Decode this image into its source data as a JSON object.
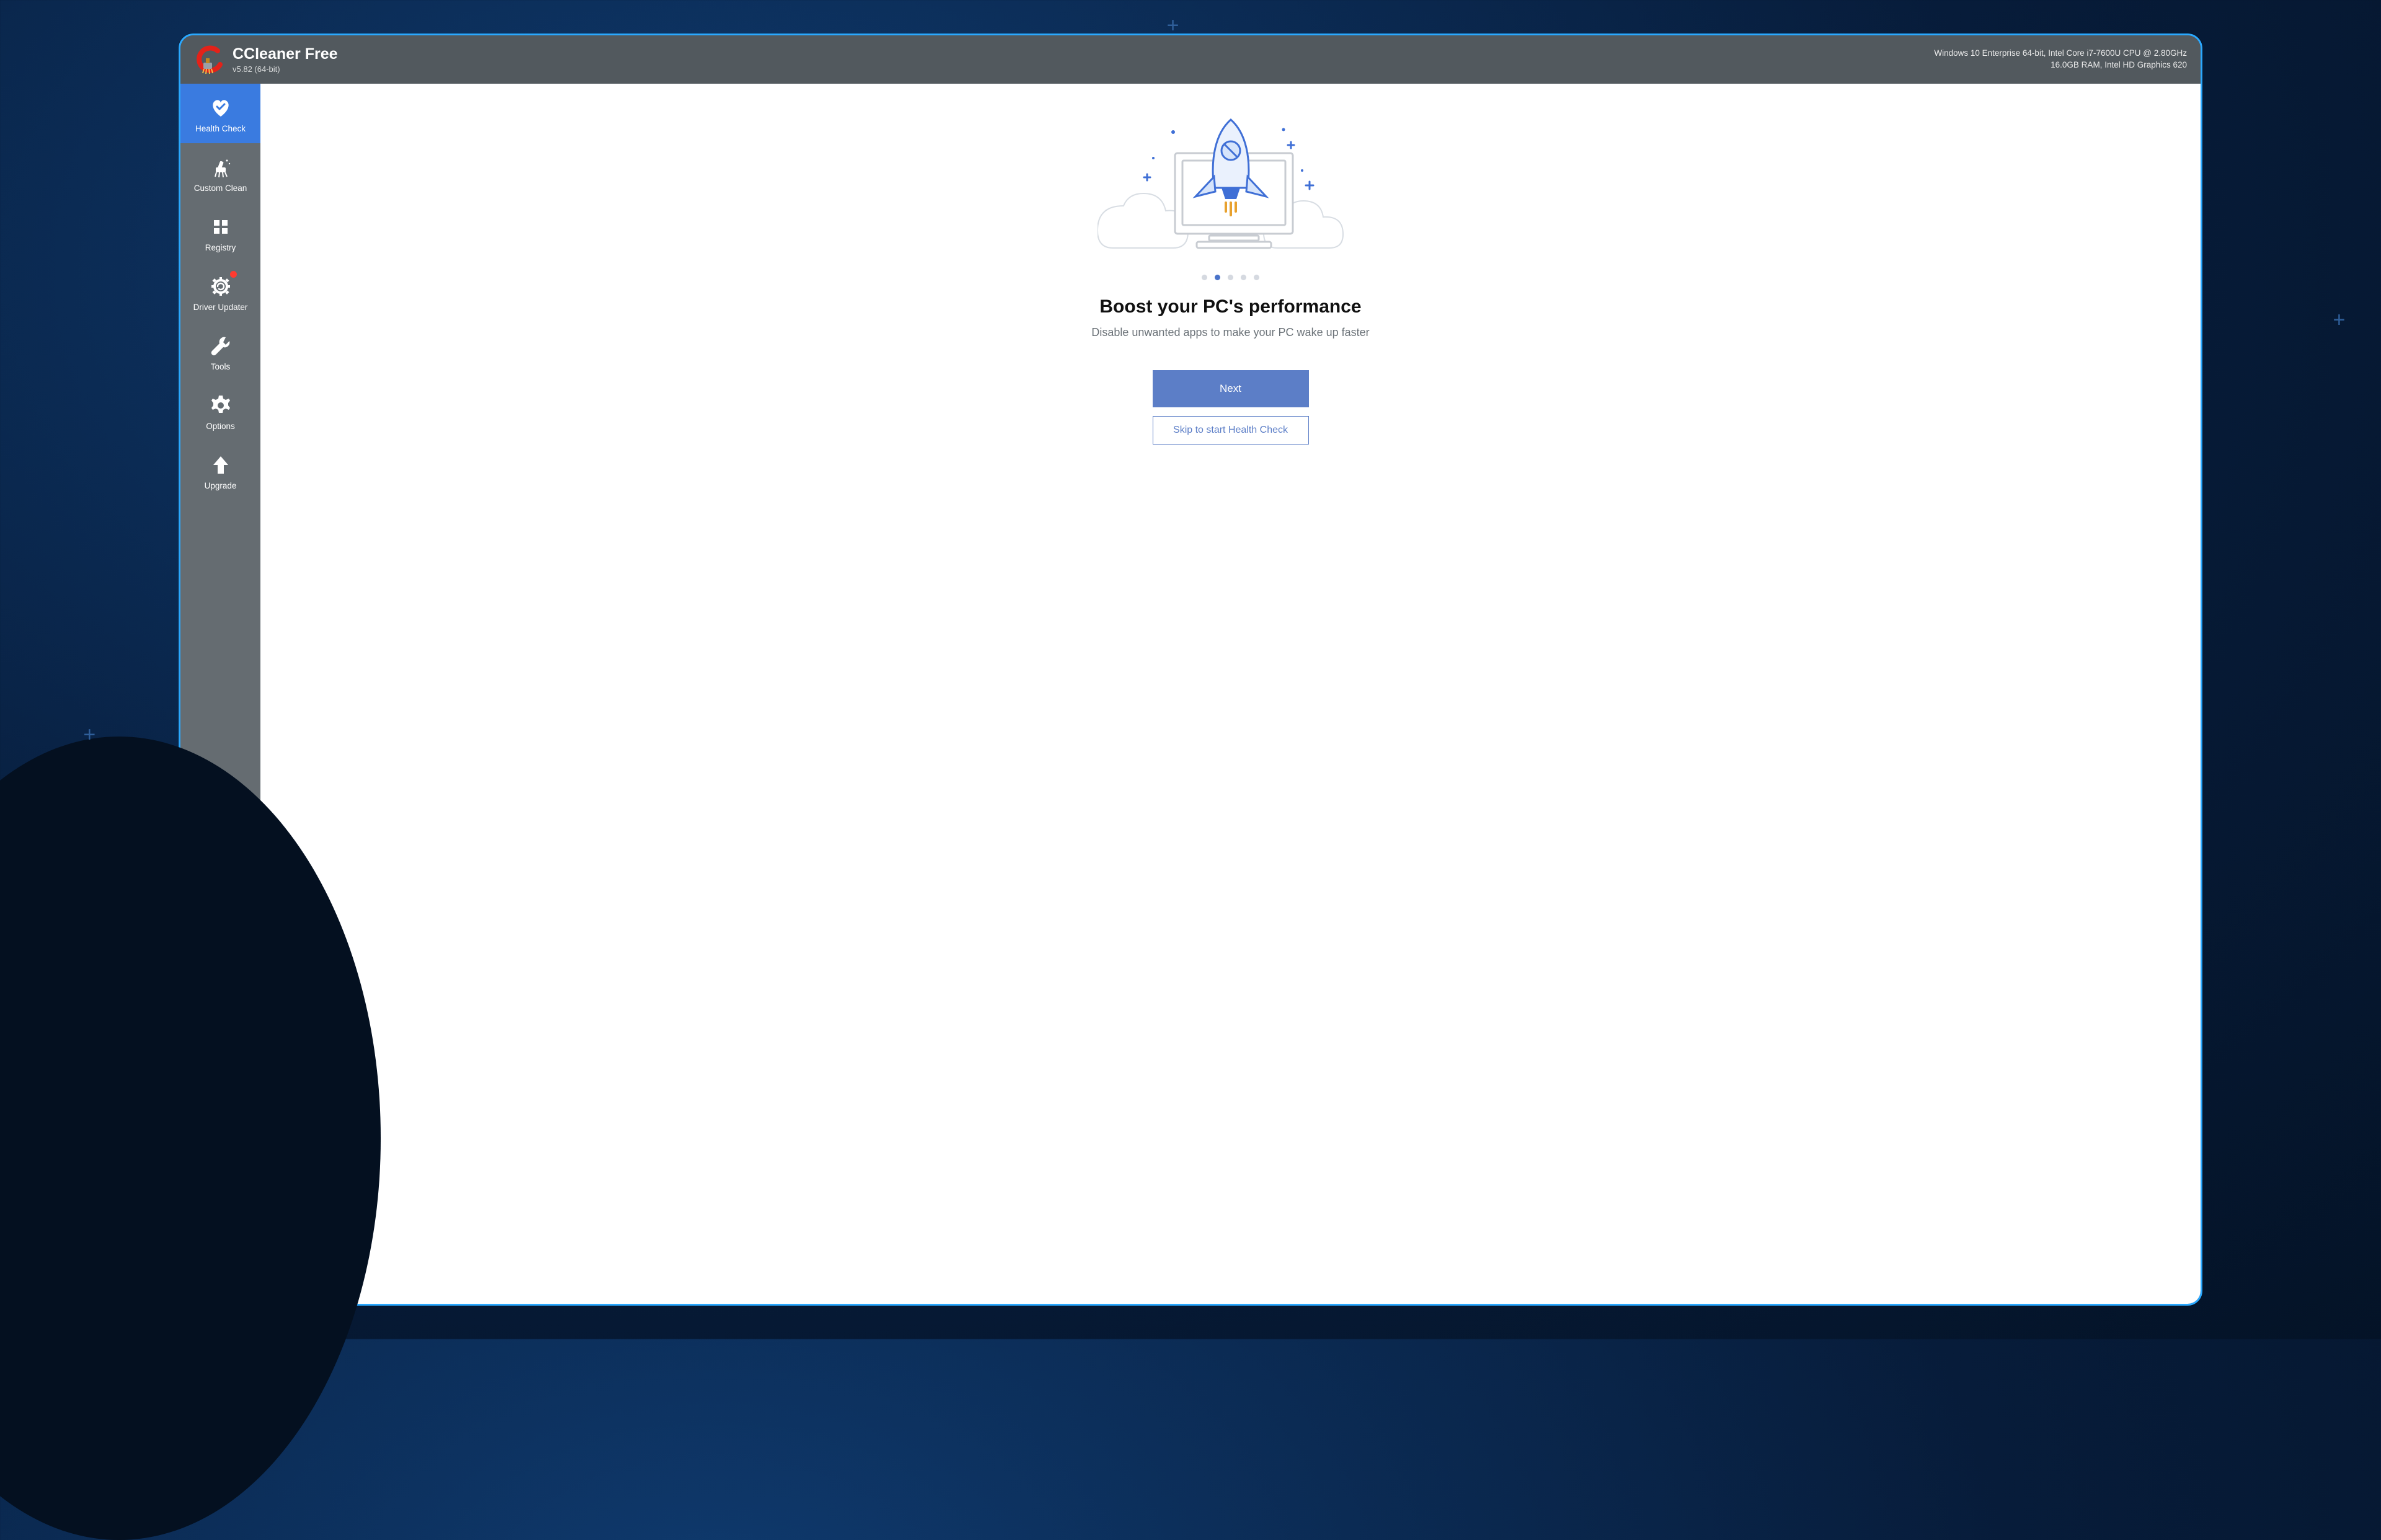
{
  "header": {
    "app_title": "CCleaner Free",
    "app_version": "v5.82 (64-bit)",
    "sys_line1": "Windows 10 Enterprise 64-bit, Intel Core i7-7600U CPU @ 2.80GHz",
    "sys_line2": "16.0GB RAM, Intel HD Graphics 620"
  },
  "sidebar": {
    "items": [
      {
        "label": "Health Check",
        "icon": "heart-check-icon",
        "active": true,
        "notification": false
      },
      {
        "label": "Custom Clean",
        "icon": "brush-icon",
        "active": false,
        "notification": false
      },
      {
        "label": "Registry",
        "icon": "grid-icon",
        "active": false,
        "notification": false
      },
      {
        "label": "Driver Updater",
        "icon": "gear-refresh-icon",
        "active": false,
        "notification": true
      },
      {
        "label": "Tools",
        "icon": "wrench-icon",
        "active": false,
        "notification": false
      },
      {
        "label": "Options",
        "icon": "gear-icon",
        "active": false,
        "notification": false
      },
      {
        "label": "Upgrade",
        "icon": "arrow-up-icon",
        "active": false,
        "notification": false
      }
    ]
  },
  "main": {
    "pager": {
      "count": 5,
      "active_index": 1
    },
    "headline": "Boost your PC's performance",
    "subhead": "Disable unwanted apps to make your PC wake up faster",
    "primary_button": "Next",
    "secondary_button": "Skip to start Health Check"
  },
  "colors": {
    "accent": "#3a7be0",
    "button": "#5c7ec7",
    "frame": "#2aa8ff"
  }
}
